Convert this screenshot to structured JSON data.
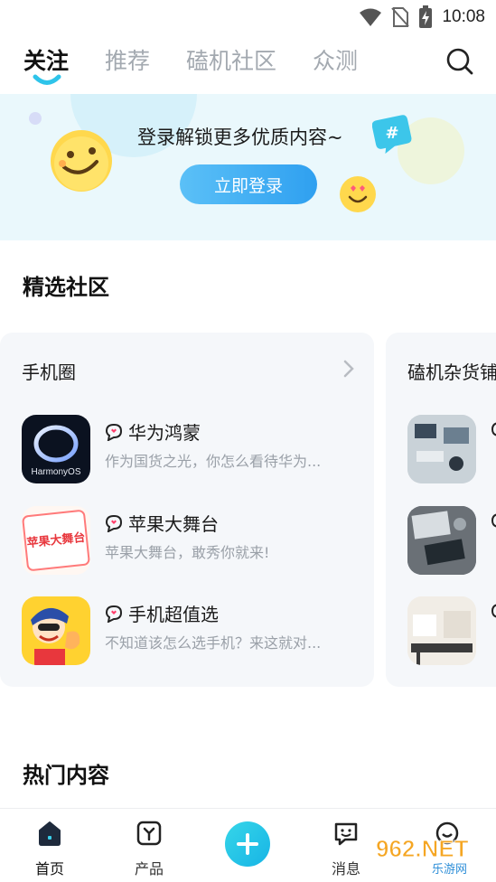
{
  "status_bar": {
    "time": "10:08",
    "icons": [
      "wifi-icon",
      "no-sim-icon",
      "battery-charging-icon"
    ]
  },
  "top_tabs": [
    {
      "label": "关注",
      "active": true
    },
    {
      "label": "推荐",
      "active": false
    },
    {
      "label": "磕机社区",
      "active": false
    },
    {
      "label": "众测",
      "active": false
    }
  ],
  "banner": {
    "text": "登录解锁更多优质内容~",
    "button_label": "立即登录"
  },
  "featured": {
    "title": "精选社区",
    "cards": [
      {
        "title": "手机圈",
        "items": [
          {
            "name": "华为鸿蒙",
            "desc": "作为国货之光，你怎么看待华为...",
            "thumb_text": "HarmonyOS"
          },
          {
            "name": "苹果大舞台",
            "desc": "苹果大舞台，敢秀你就来!",
            "thumb_text": "苹果大舞台"
          },
          {
            "name": "手机超值选",
            "desc": "不知道该怎么选手机？来这就对...",
            "thumb_text": ""
          }
        ]
      },
      {
        "title": "磕机杂货铺",
        "items": [
          {
            "name": "",
            "desc": ""
          },
          {
            "name": "",
            "desc": ""
          },
          {
            "name": "",
            "desc": ""
          }
        ]
      }
    ]
  },
  "hot": {
    "title": "热门内容"
  },
  "bottom_nav": [
    {
      "label": "首页",
      "icon": "home-icon",
      "active": true
    },
    {
      "label": "产品",
      "icon": "product-icon",
      "active": false
    },
    {
      "label": "",
      "icon": "plus-icon",
      "active": false
    },
    {
      "label": "消息",
      "icon": "message-icon",
      "active": false
    },
    {
      "label": "",
      "icon": "profile-icon",
      "active": false
    }
  ],
  "watermark": {
    "text": "962.NET",
    "subtext": "乐游网"
  },
  "colors": {
    "accent": "#2fa0f0",
    "teal": "#17b4e6",
    "banner_bg": "#eaf8fc",
    "card_bg": "#f5f7fa"
  }
}
